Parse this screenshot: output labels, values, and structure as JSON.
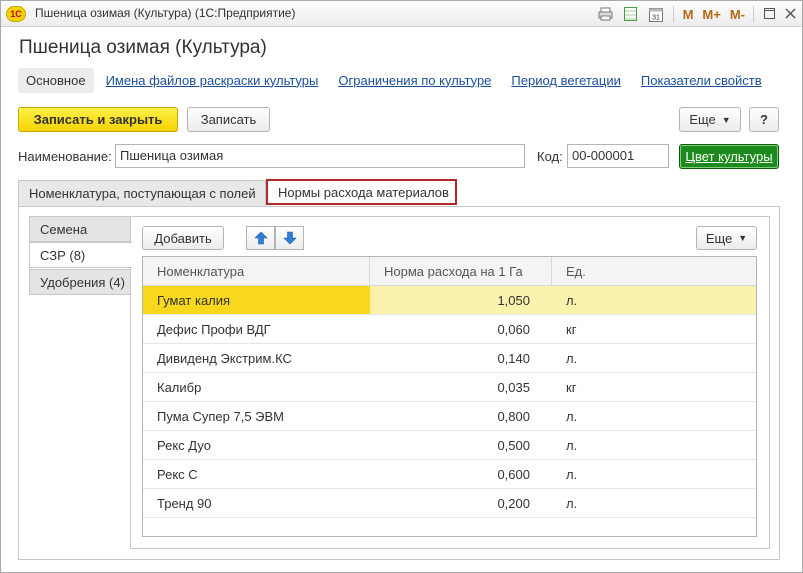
{
  "window": {
    "app_logo": "1С",
    "title": "Пшеница озимая (Культура)  (1С:Предприятие)",
    "icons": [
      "print-icon",
      "table-icon",
      "calendar-icon"
    ],
    "calendar_day": "31",
    "memory_buttons": [
      "M",
      "M+",
      "M-"
    ]
  },
  "form": {
    "title": "Пшеница озимая (Культура)"
  },
  "nav": {
    "items": [
      {
        "label": "Основное",
        "active": true
      },
      {
        "label": "Имена файлов раскраски культуры"
      },
      {
        "label": "Ограничения по культуре"
      },
      {
        "label": "Период вегетации"
      },
      {
        "label": "Показатели свойств"
      }
    ]
  },
  "toolbar": {
    "save_close_label": "Записать и закрыть",
    "save_label": "Записать",
    "more_label": "Еще",
    "help_label": "?"
  },
  "fields": {
    "name_label": "Наименование:",
    "name_value": "Пшеница озимая",
    "code_label": "Код:",
    "code_value": "00-000001",
    "color_button_label": "Цвет культуры"
  },
  "tabs": [
    {
      "label": "Номенклатура, поступающая с полей"
    },
    {
      "label": "Нормы расхода материалов",
      "active": true
    }
  ],
  "subtabs": [
    {
      "label": "Семена"
    },
    {
      "label": "СЗР (8)",
      "active": true
    },
    {
      "label": "Удобрения (4)"
    }
  ],
  "table_toolbar": {
    "add_label": "Добавить",
    "more_label": "Еще"
  },
  "table": {
    "columns": [
      "Номенклатура",
      "Норма расхода на 1 Га",
      "Ед."
    ],
    "rows": [
      {
        "name": "Гумат калия",
        "rate": "1,050",
        "unit": "л.",
        "selected": true
      },
      {
        "name": "Дефис Профи ВДГ",
        "rate": "0,060",
        "unit": "кг"
      },
      {
        "name": "Дивиденд Экстрим.КС",
        "rate": "0,140",
        "unit": "л."
      },
      {
        "name": "Калибр",
        "rate": "0,035",
        "unit": "кг"
      },
      {
        "name": "Пума Супер 7,5 ЭВМ",
        "rate": "0,800",
        "unit": "л."
      },
      {
        "name": "Рекс Дуо",
        "rate": "0,500",
        "unit": "л."
      },
      {
        "name": "Рекс С",
        "rate": "0,600",
        "unit": "л."
      },
      {
        "name": "Тренд 90",
        "rate": "0,200",
        "unit": "л."
      }
    ]
  },
  "colors": {
    "primary_button": "#f7d400",
    "color_button": "#1c8a1c",
    "active_tab_border": "#b02828",
    "link": "#1b4f9c",
    "selected_row": "#f9d71c"
  }
}
